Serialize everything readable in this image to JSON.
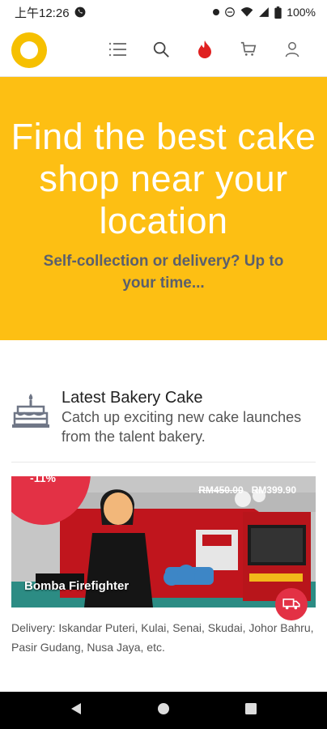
{
  "status_bar": {
    "time": "上午12:26",
    "battery": "100%"
  },
  "nav": {
    "icons": [
      "menu-icon",
      "search-icon",
      "fire-icon",
      "cart-icon",
      "user-icon"
    ],
    "accent_color": "#E02020"
  },
  "hero": {
    "title": "Find the best cake shop near your location",
    "subtitle": "Self-collection or delivery? Up to your time...",
    "background": "#FDBF13"
  },
  "section": {
    "title": "Latest Bakery Cake",
    "description": "Catch up exciting new cake launches from the talent bakery."
  },
  "product": {
    "discount": "-11%",
    "old_price": "RM450.00",
    "new_price": "RM399.90",
    "name": "Bomba Firefighter",
    "delivery": "Delivery: Iskandar Puteri, Kulai, Senai, Skudai, Johor Bahru, Pasir Gudang, Nusa Jaya, etc."
  },
  "system_nav": {
    "icons": [
      "back-icon",
      "home-icon",
      "recents-icon"
    ]
  }
}
